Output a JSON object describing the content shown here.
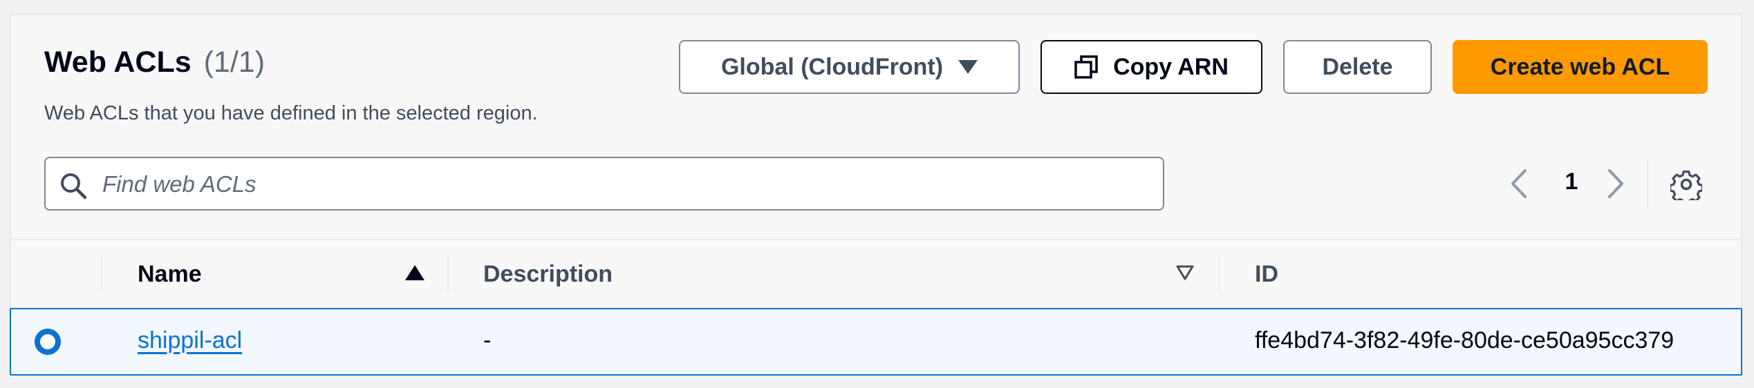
{
  "header": {
    "title": "Web ACLs",
    "count": "(1/1)",
    "description": "Web ACLs that you have defined in the selected region."
  },
  "actions": {
    "region_label": "Global (CloudFront)",
    "copy_arn_label": "Copy ARN",
    "delete_label": "Delete",
    "create_label": "Create web ACL"
  },
  "search": {
    "placeholder": "Find web ACLs",
    "value": ""
  },
  "pagination": {
    "current_page": "1"
  },
  "table": {
    "columns": [
      {
        "label": "Name",
        "sort": "ascending"
      },
      {
        "label": "Description",
        "sort": "none"
      },
      {
        "label": "ID",
        "sort": "none"
      }
    ],
    "rows": [
      {
        "selected": true,
        "name": "shippil-acl",
        "description": "-",
        "id": "ffe4bd74-3f82-49fe-80de-ce50a95cc379"
      }
    ]
  },
  "icons": {
    "region_dropdown": "caret-down-icon",
    "copy": "copy-icon",
    "search": "search-icon",
    "prev": "chevron-left-icon",
    "next": "chevron-right-icon",
    "settings": "gear-icon",
    "sort_asc": "sort-ascending-icon",
    "sort_none": "sort-descending-outline-icon",
    "row_radio": "radio-selected-icon"
  },
  "colors": {
    "accent": "#0972d3",
    "primary_button": "#ff9900",
    "selected_row_bg": "#f2f8fd"
  }
}
